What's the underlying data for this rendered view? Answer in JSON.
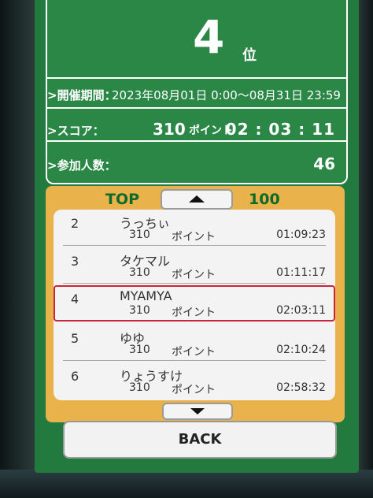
{
  "colors": {
    "screen_green": "#237a3e",
    "panel_orange": "#e9b24a",
    "highlight_red": "#c8243a"
  },
  "result": {
    "rank": "4",
    "rank_suffix": "位",
    "period_label": ">開催期間：",
    "period_value": "2023年08月01日 0:00～08月31日 23:59",
    "score_label": ">スコア：",
    "score_value": "310",
    "score_unit": "ポイント",
    "score_time": "02 : 03 : 11",
    "participants_label": ">参加人数：",
    "participants_value": "46"
  },
  "ranking": {
    "top_label": "TOP",
    "top_count": "100",
    "up_icon": "triangle-up",
    "down_icon": "triangle-down",
    "entries": [
      {
        "rank": "2",
        "name": "うっちぃ",
        "points": "310",
        "unit": "ポイント",
        "time": "01:09:23"
      },
      {
        "rank": "3",
        "name": "タケマル",
        "points": "310",
        "unit": "ポイント",
        "time": "01:11:17"
      },
      {
        "rank": "4",
        "name": "MYAMYA",
        "points": "310",
        "unit": "ポイント",
        "time": "02:03:11"
      },
      {
        "rank": "5",
        "name": "ゆゆ",
        "points": "310",
        "unit": "ポイント",
        "time": "02:10:24"
      },
      {
        "rank": "6",
        "name": "りょうすけ",
        "points": "310",
        "unit": "ポイント",
        "time": "02:58:32"
      }
    ]
  },
  "back_label": "BACK"
}
